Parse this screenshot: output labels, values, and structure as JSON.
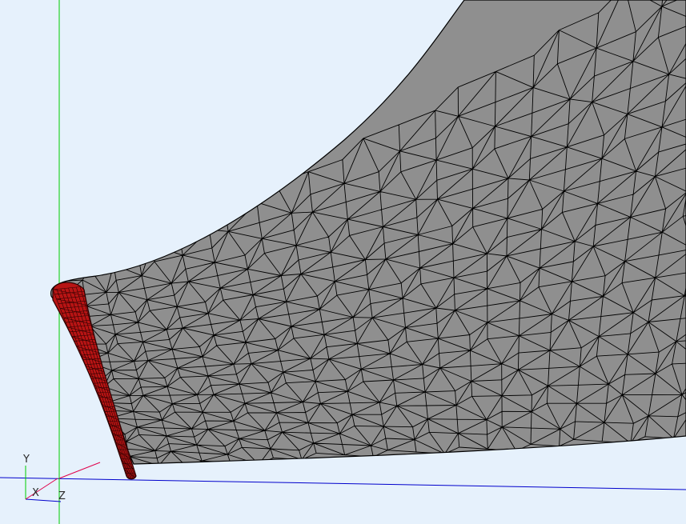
{
  "viewport": {
    "background": "#e6f1fc"
  },
  "colors": {
    "mesh_fill": "#8f8f8f",
    "mesh_edges": "#000000",
    "selected_fill": "#b81414",
    "axis_x": "#e0004a",
    "axis_y": "#00d000",
    "axis_z": "#0000cc"
  },
  "triad": {
    "x_label": "X",
    "y_label": "Y",
    "z_label": "Z"
  }
}
